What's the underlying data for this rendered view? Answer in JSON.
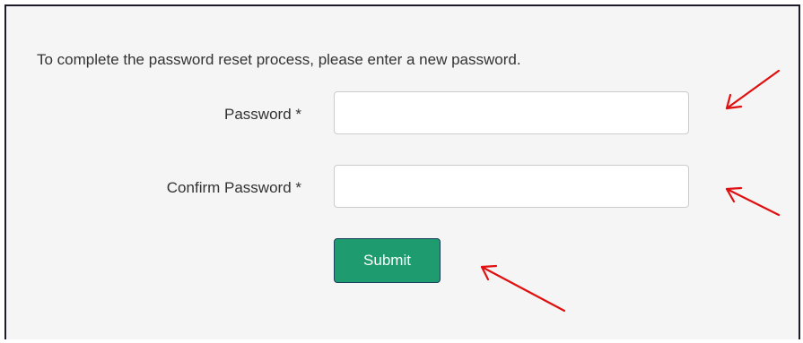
{
  "form": {
    "instructions": "To complete the password reset process, please enter a new password.",
    "password_label": "Password *",
    "password_value": "",
    "confirm_label": "Confirm Password *",
    "confirm_value": "",
    "submit_label": "Submit"
  },
  "colors": {
    "panel_background": "#f5f5f5",
    "submit_button": "#1e9b6f",
    "annotation_arrow": "#e01010"
  }
}
